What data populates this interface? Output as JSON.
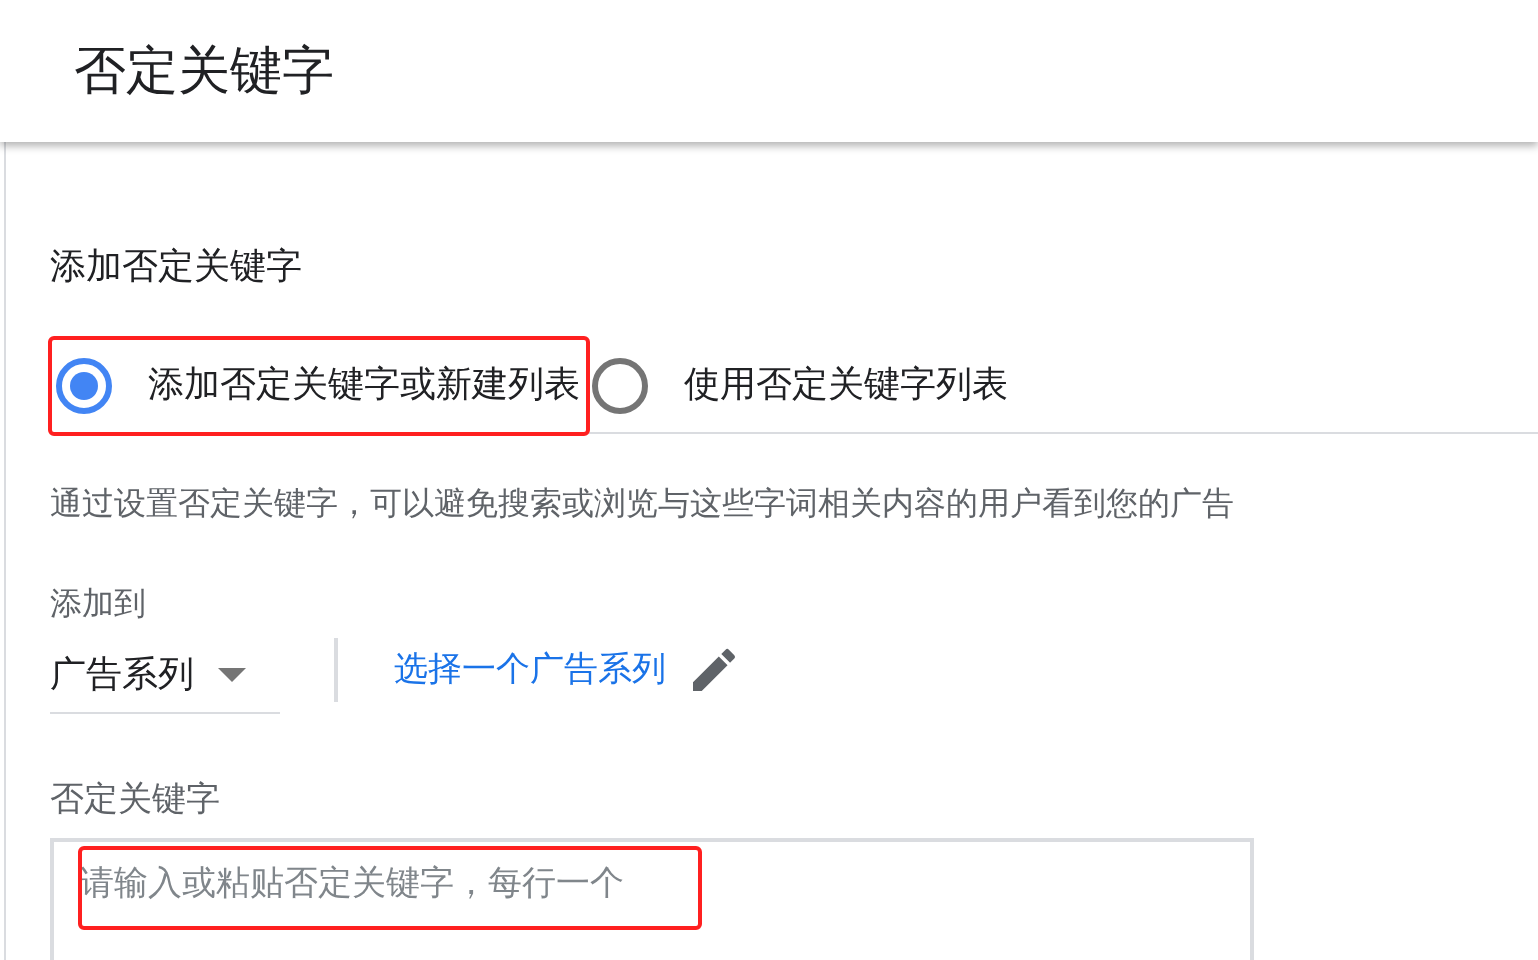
{
  "header": {
    "title": "否定关键字"
  },
  "section_title": "添加否定关键字",
  "options": [
    {
      "label": "添加否定关键字或新建列表",
      "selected": true,
      "highlighted": true
    },
    {
      "label": "使用否定关键字列表",
      "selected": false,
      "highlighted": false
    }
  ],
  "description": "通过设置否定关键字，可以避免搜索或浏览与这些字词相关内容的用户看到您的广告",
  "add_to": {
    "label": "添加到",
    "value": "广告系列",
    "link": "选择一个广告系列"
  },
  "keywords": {
    "label": "否定关键字",
    "placeholder": "请输入或粘贴否定关键字，每行一个",
    "highlighted": true
  }
}
